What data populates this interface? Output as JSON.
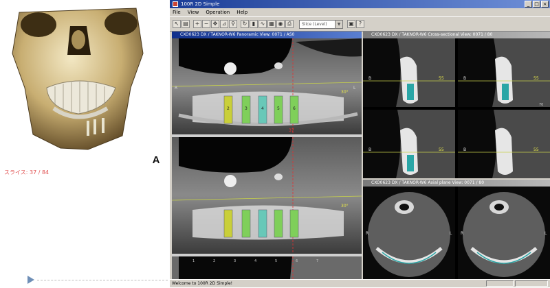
{
  "left_panel": {
    "slice_label": "スライス: 37 / 84",
    "view_letter": "A"
  },
  "window": {
    "title": "100R 2D Simple",
    "menu": [
      "File",
      "View",
      "Operation",
      "Help"
    ],
    "toolbar_combo": "Slice (Level)",
    "status": "Welcome to 100R 2D Simple!"
  },
  "panes": {
    "panoramic_title": "CXO0623 DX / TAKNOR-W6 Panoramic View: 0071 / AS0",
    "axial_title": "CXO0623 DX / TAKNOR-W6 Axial plane View: 0071 / 80",
    "cross_title": "CXO0623 DX / TAKNOR-W6 Cross-sectional View: 0071 / 80"
  },
  "overlays": {
    "pan_angle": "30°",
    "pan_left_marker": "R",
    "pan_right_marker": "L",
    "pan_slice_no": "37",
    "pan_ruler": [
      "1",
      "2",
      "3",
      "4",
      "5",
      "6",
      "7"
    ],
    "implants": [
      "2",
      "3",
      "4",
      "5",
      "6"
    ],
    "cross_angle": "55",
    "cross_mark": "B",
    "cross_index": "70",
    "axial_left": "R",
    "axial_right": "L"
  }
}
